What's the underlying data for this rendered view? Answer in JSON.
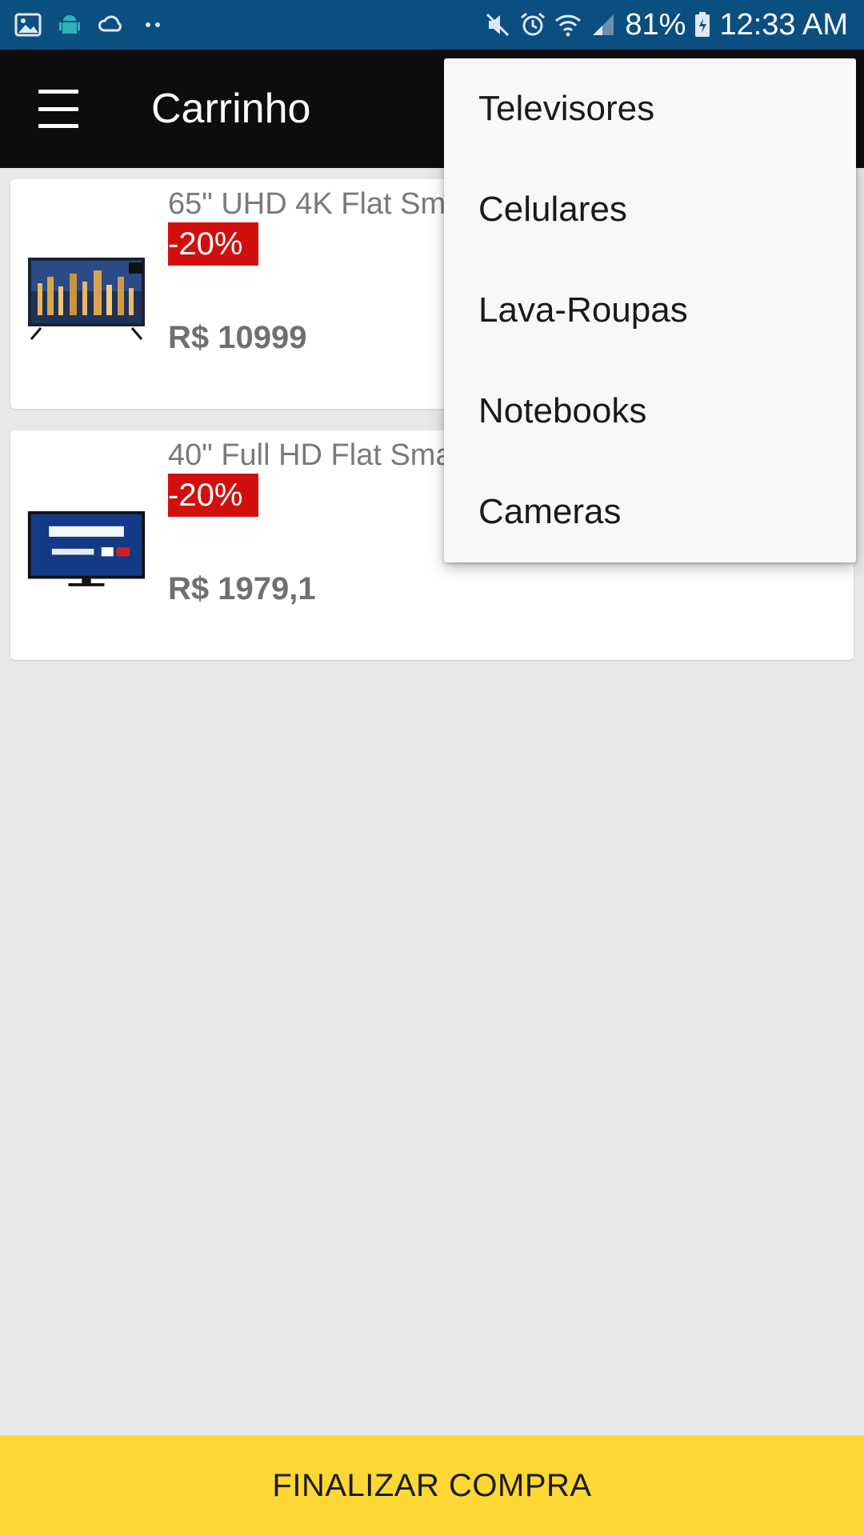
{
  "status_bar": {
    "battery_pct": "81%",
    "time": "12:33 AM",
    "left_icons": [
      "gallery-icon",
      "android-icon",
      "sync-cloud-icon",
      "more-dots-icon"
    ],
    "right_icons": [
      "mute-icon",
      "alarm-icon",
      "wifi-icon",
      "signal-icon",
      "battery-icon"
    ]
  },
  "app_bar": {
    "title": "Carrinho"
  },
  "cart": {
    "items": [
      {
        "name": "65\" UHD 4K Flat Sm",
        "discount": "-20%",
        "price": "R$ 10999",
        "thumb": "tv-4k-thumbnail"
      },
      {
        "name": "40\" Full HD Flat Sma",
        "discount": "-20%",
        "price": "R$ 1979,1",
        "thumb": "samsung-smart-tv-thumbnail"
      }
    ]
  },
  "dropdown": {
    "items": [
      "Televisores",
      "Celulares",
      "Lava-Roupas",
      "Notebooks",
      "Cameras"
    ]
  },
  "checkout": {
    "label": "FINALIZAR COMPRA"
  },
  "colors": {
    "status_bar": "#0b4f80",
    "app_bar": "#0d0d0d",
    "discount_badge": "#d20f0f",
    "checkout_button": "#fdd835",
    "background": "#e8e8e8"
  }
}
